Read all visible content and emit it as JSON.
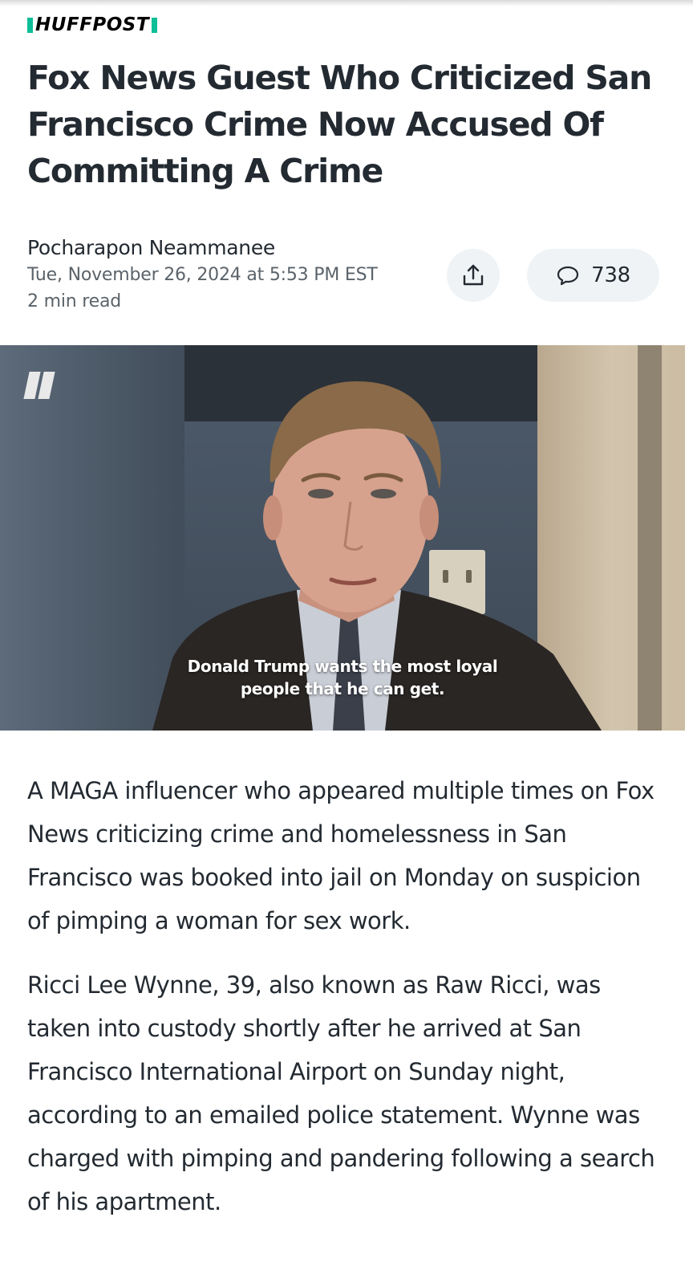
{
  "brand": {
    "name": "HUFFPOST",
    "accent_color": "#0dbe98"
  },
  "article": {
    "headline": "Fox News Guest Who Criticized San Francisco Crime Now Accused Of Committing A Crime",
    "author": "Pocharapon Neammanee",
    "date": "Tue, November 26, 2024 at 5:53 PM EST",
    "read_time": "2 min read",
    "comment_count": "738",
    "share_icon": "share-icon",
    "comment_icon": "comment-bubble-icon"
  },
  "video": {
    "caption_line1": "Donald Trump wants the most loyal",
    "caption_line2": "people that he can get.",
    "logo_icon": "huffpost-quote-logo-icon"
  },
  "body": {
    "paragraphs": [
      "A MAGA influencer who appeared multiple times on Fox News criticizing crime and homelessness in San Francisco was booked into jail on Monday on suspicion of pimping a woman for sex work.",
      "Ricci Lee Wynne, 39, also known as Raw Ricci, was taken into custody shortly after he arrived at San Francisco International Airport on Sunday night, according to an emailed police statement. Wynne was charged with pimping and pandering following a search of his apartment."
    ]
  }
}
